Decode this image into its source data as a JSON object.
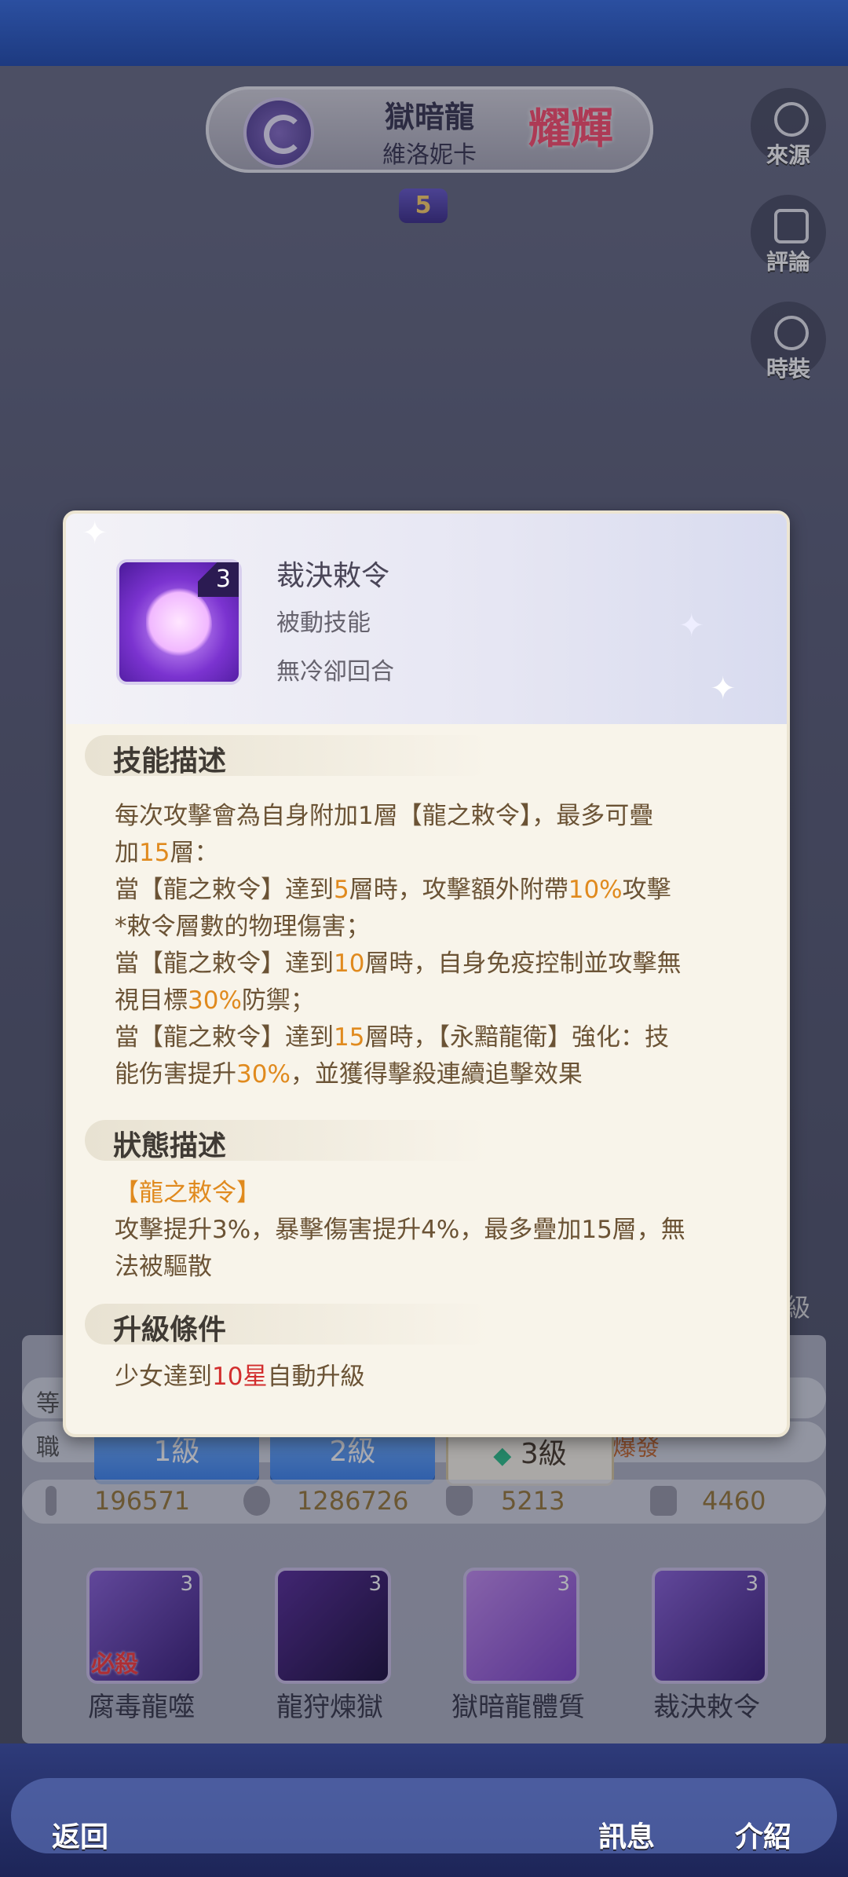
{
  "header": {
    "character_title": "獄暗龍",
    "character_name": "維洛妮卡",
    "rarity_badge": "耀輝",
    "star_level": "5"
  },
  "side_buttons": [
    {
      "label": "來源",
      "icon": "location-pin-icon"
    },
    {
      "label": "評論",
      "icon": "chat-bubble-icon"
    },
    {
      "label": "時裝",
      "icon": "outfit-icon"
    }
  ],
  "popup": {
    "skill_name": "裁決敕令",
    "skill_level": "3",
    "skill_type": "被動技能",
    "cooldown": "無冷卻回合",
    "section_skill_desc": "技能描述",
    "skill_desc_lines": [
      [
        "每次攻擊會為自身附加1層【龍之敕令】，最多可疊"
      ],
      [
        "加",
        "15",
        "層："
      ],
      [
        "當【龍之敕令】達到",
        "5",
        "層時，攻擊額外附帶",
        "10%",
        "攻擊"
      ],
      [
        "*敕令層數的物理傷害；"
      ],
      [
        "當【龍之敕令】達到",
        "10",
        "層時，自身免疫控制並攻擊無"
      ],
      [
        "視目標",
        "30%",
        "防禦；"
      ],
      [
        "當【龍之敕令】達到",
        "15",
        "層時，【永黯龍衛】強化：技"
      ],
      [
        "能伤害提升",
        "30%",
        "，並獲得擊殺連續追擊效果"
      ]
    ],
    "section_status_desc": "狀態描述",
    "status_tag": "【龍之敕令】",
    "status_desc_lines": [
      "攻擊提升3%，暴擊傷害提升4%，最多疊加15層，無",
      "法被驅散"
    ],
    "section_upgrade": "升級條件",
    "upgrade_prefix": "少女達到",
    "upgrade_highlight": "10星",
    "upgrade_suffix": "自動升級"
  },
  "info_rows": {
    "row1_label": "等",
    "row2_label": "職",
    "row2_right": "爆發",
    "right_badge": "級"
  },
  "level_tabs": [
    {
      "label": "1級",
      "active": false
    },
    {
      "label": "2級",
      "active": false
    },
    {
      "label": "3級",
      "active": true
    }
  ],
  "stats": [
    {
      "icon": "sword-icon",
      "value": "196571"
    },
    {
      "icon": "heart-icon",
      "value": "1286726"
    },
    {
      "icon": "shield-icon",
      "value": "5213"
    },
    {
      "icon": "boot-icon",
      "value": "4460"
    }
  ],
  "skills": [
    {
      "name": "腐毒龍噬",
      "level": "3",
      "tag": "必殺"
    },
    {
      "name": "龍狩煉獄",
      "level": "3",
      "tag": ""
    },
    {
      "name": "獄暗龍體質",
      "level": "3",
      "tag": ""
    },
    {
      "name": "裁決敕令",
      "level": "3",
      "tag": ""
    }
  ],
  "bottom_nav": {
    "back": "返回",
    "info": "訊息",
    "intro": "介紹"
  },
  "colors": {
    "highlight_orange": "#e08a1e",
    "highlight_red": "#d22e2e",
    "tab_blue": "#3f86f0"
  }
}
